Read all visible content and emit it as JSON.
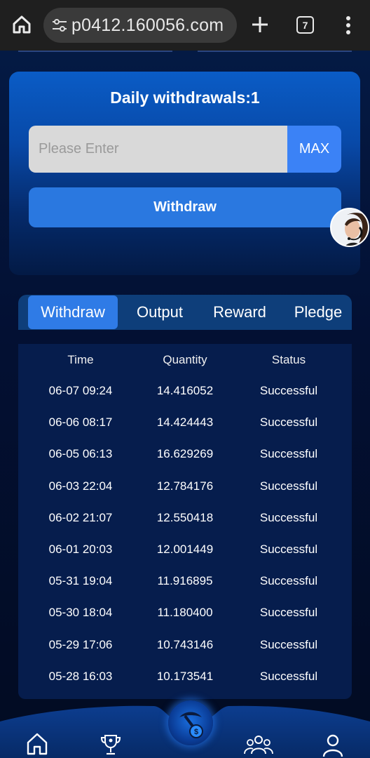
{
  "browser": {
    "url": "p0412.160056.com",
    "tab_count": "7"
  },
  "withdraw_card": {
    "title": "Daily withdrawals:1",
    "amount_placeholder": "Please Enter",
    "max_label": "MAX",
    "withdraw_label": "Withdraw"
  },
  "tabs": [
    {
      "label": "Withdraw",
      "active": true
    },
    {
      "label": "Output",
      "active": false
    },
    {
      "label": "Reward",
      "active": false
    },
    {
      "label": "Pledge",
      "active": false
    }
  ],
  "table": {
    "headers": [
      "Time",
      "Quantity",
      "Status"
    ],
    "rows": [
      [
        "06-07 09:24",
        "14.416052",
        "Successful"
      ],
      [
        "06-06 08:17",
        "14.424443",
        "Successful"
      ],
      [
        "06-05 06:13",
        "16.629269",
        "Successful"
      ],
      [
        "06-03 22:04",
        "12.784176",
        "Successful"
      ],
      [
        "06-02 21:07",
        "12.550418",
        "Successful"
      ],
      [
        "06-01 20:03",
        "12.001449",
        "Successful"
      ],
      [
        "05-31 19:04",
        "11.916895",
        "Successful"
      ],
      [
        "05-30 18:04",
        "11.180400",
        "Successful"
      ],
      [
        "05-29 17:06",
        "10.743146",
        "Successful"
      ],
      [
        "05-28 16:03",
        "10.173541",
        "Successful"
      ]
    ]
  },
  "bottom_nav": [
    "home-icon",
    "trophy-icon",
    "mining-icon",
    "team-icon",
    "profile-icon"
  ],
  "colors": {
    "accent": "#2f7be6",
    "background": "#020b22",
    "card": "#0a5cc6"
  }
}
